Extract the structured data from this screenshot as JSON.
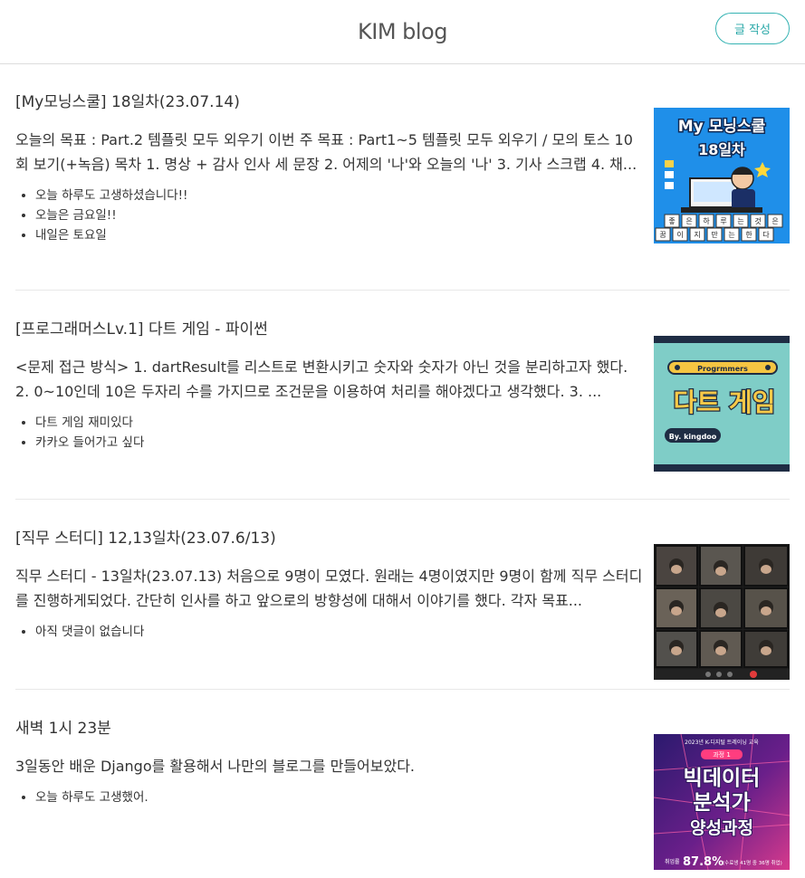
{
  "header": {
    "title": "KIM blog",
    "write_label": "글 작성"
  },
  "posts": [
    {
      "title": "[My모닝스쿨] 18일차(23.07.14)",
      "excerpt": "오늘의 목표 : Part.2 템플릿 모두 외우기 이번 주 목표 : Part1~5 템플릿 모두 외우기 / 모의 토스 10회 보기(+녹음) 목차 1. 명상 + 감사 인사 세 문장 2. 어제의 '나'와 오늘의 '나' 3. 기사 스크랩 4. 채...",
      "comments": [
        "오늘 하루도 고생하셨습니다!!",
        "오늘은 금요일!!",
        "내일은 토요일"
      ],
      "thumb": {
        "line1": "My 모닝스쿨",
        "line2": "18일차",
        "row1": [
          "좋",
          "은",
          "하",
          "루",
          "는",
          "것",
          "은"
        ],
        "row2": [
          "꿈",
          "이",
          "지",
          "만",
          "는",
          "한",
          "다"
        ]
      }
    },
    {
      "title": "[프로그래머스Lv.1] 다트 게임 - 파이썬",
      "excerpt": "<문제 접근 방식> 1. dartResult를 리스트로 변환시키고 숫자와 숫자가 아닌 것을 분리하고자 했다. 2. 0~10인데 10은 두자리 수를 가지므로 조건문을 이용하여 처리를 해야겠다고 생각했다. 3. ...",
      "comments": [
        "다트 게임 재미있다",
        "카카오 들어가고 싶다"
      ],
      "thumb": {
        "badge": "Progrmmers",
        "title": "다트 게임",
        "byline": "By. kingdoo"
      }
    },
    {
      "title": "[직무 스터디] 12,13일차(23.07.6/13)",
      "excerpt": "직무 스터디 - 13일차(23.07.13) 처음으로 9명이 모였다. 원래는 4명이였지만 9명이 함께 직무 스터디를 진행하게되었다. 간단히 인사를 하고 앞으로의 방향성에 대해서 이야기를 했다. 각자 목표...",
      "comments": [
        "아직 댓글이 없습니다"
      ]
    },
    {
      "title": "새벽 1시 23분",
      "excerpt": "3일동안 배운 Django를 활용해서 나만의 블로그를 만들어보았다.",
      "comments": [
        "오늘 하루도 고생했어."
      ],
      "thumb": {
        "top": "2023년 K-디지털 트레이닝 교육",
        "tag": "과정 1",
        "line1": "빅데이터",
        "line2": "분석가",
        "line3": "양성과정",
        "stat_label": "취업률",
        "stat": "87.8%",
        "stat_note": "(수료생 41명 중 36명 취업)"
      }
    }
  ],
  "colors": {
    "accent": "#2aa8a8",
    "divider": "#e8e8e8"
  }
}
